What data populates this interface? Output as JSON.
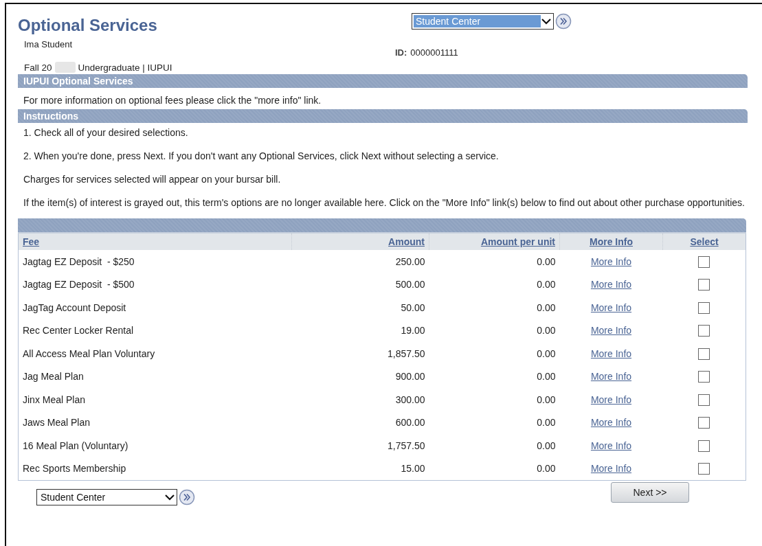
{
  "title": "Optional Services",
  "top_nav": {
    "value": "Student Center",
    "highlighted": true
  },
  "student_name": "Ima Student",
  "id_label": "ID:",
  "id_value": "0000001111",
  "term_prefix": "Fall 20",
  "term_rest": "Undergraduate | IUPUI",
  "section_optional": {
    "heading": "IUPUI Optional Services",
    "text": "For more information on optional fees please click the \"more info\" link."
  },
  "section_instructions": {
    "heading": "Instructions",
    "paragraphs": [
      "1. Check all of your desired selections.",
      "2. When you're done, press Next. If you don't want any Optional Services, click Next without selecting a service.",
      "Charges for services selected will appear on your bursar bill.",
      "If the item(s) of interest is grayed out, this term's options are no longer available here. Click on the \"More Info\" link(s) below to find out about other purchase opportunities."
    ]
  },
  "table": {
    "columns": [
      "Fee",
      "Amount",
      "Amount per unit",
      "More Info",
      "Select"
    ],
    "rows": [
      {
        "fee": "Jagtag EZ Deposit  - $250",
        "amount": "250.00",
        "per_unit": "0.00",
        "link": "More Info",
        "checked": false
      },
      {
        "fee": "Jagtag EZ Deposit  - $500",
        "amount": "500.00",
        "per_unit": "0.00",
        "link": "More Info",
        "checked": false
      },
      {
        "fee": "JagTag Account Deposit",
        "amount": "50.00",
        "per_unit": "0.00",
        "link": "More Info",
        "checked": false
      },
      {
        "fee": "Rec Center Locker Rental",
        "amount": "19.00",
        "per_unit": "0.00",
        "link": "More Info",
        "checked": false
      },
      {
        "fee": "All Access Meal Plan Voluntary",
        "amount": "1,857.50",
        "per_unit": "0.00",
        "link": "More Info",
        "checked": false
      },
      {
        "fee": "Jag Meal Plan",
        "amount": "900.00",
        "per_unit": "0.00",
        "link": "More Info",
        "checked": false
      },
      {
        "fee": "Jinx Meal Plan",
        "amount": "300.00",
        "per_unit": "0.00",
        "link": "More Info",
        "checked": false
      },
      {
        "fee": "Jaws Meal Plan",
        "amount": "600.00",
        "per_unit": "0.00",
        "link": "More Info",
        "checked": false
      },
      {
        "fee": "16 Meal Plan (Voluntary)",
        "amount": "1,757.50",
        "per_unit": "0.00",
        "link": "More Info",
        "checked": false
      },
      {
        "fee": "Rec Sports Membership",
        "amount": "15.00",
        "per_unit": "0.00",
        "link": "More Info",
        "checked": false
      }
    ]
  },
  "bottom_nav": {
    "value": "Student Center",
    "highlighted": false
  },
  "next_button": "Next >>"
}
